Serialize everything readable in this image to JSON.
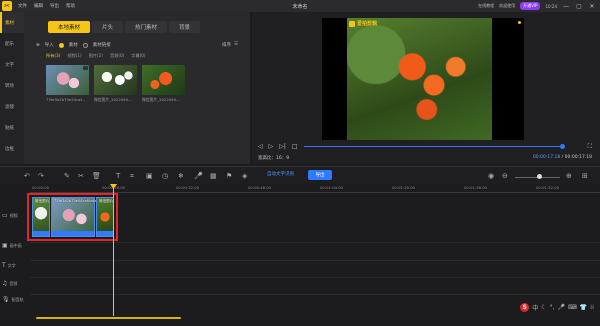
{
  "titlebar": {
    "menu": [
      "文件",
      "编辑",
      "导出",
      "帮助"
    ],
    "doc_title": "未命名",
    "links": [
      "在线教程",
      "欢迎使用"
    ],
    "vip_label": "开通VIP",
    "version": "10:24"
  },
  "sidebar": {
    "items": [
      "素材",
      "配乐",
      "文字",
      "转场",
      "滤镜",
      "贴纸",
      "边框"
    ]
  },
  "media": {
    "tabs": [
      "本地素材",
      "片头",
      "热门素材",
      "背景"
    ],
    "import_label": "导入",
    "option_a": "素材",
    "option_b": "素材链接",
    "sort_label": "排序",
    "filters": [
      "所有(3)",
      "视频(1)",
      "图片(2)",
      "音频(0)",
      "字幕(0)"
    ],
    "thumbs": [
      {
        "caption": "73fe3a2b73e54caf..."
      },
      {
        "caption": "微信图片_2022090..."
      },
      {
        "caption": "微信图片_2022090..."
      }
    ]
  },
  "preview": {
    "watermark": "爱拍剪辑",
    "ratio_label": "宽高比：",
    "ratio_value": "16：9",
    "time_current": "00:00:17.18",
    "time_total": "00:00:17.18",
    "progress": 1.0
  },
  "timeline": {
    "align_label": "自动文字识别",
    "export_label": "导出",
    "ruler": [
      "00:00:00",
      "00:00:16.00",
      "00:00:32.00",
      "00:00:48.00",
      "00:01:04.00",
      "00:01:20.00",
      "00:01:36.00",
      "00:01:52.00"
    ],
    "tracks": [
      "视频",
      "画中画",
      "文字",
      "音频",
      "配音轨"
    ],
    "clips": [
      {
        "title": "微信图片"
      },
      {
        "title": "73fe3a2b73e54caf0d6ac"
      },
      {
        "title": "微信图片"
      }
    ]
  },
  "colors": {
    "accent": "#f5c518",
    "blue": "#2f7bff",
    "selection": "#e3242b"
  }
}
